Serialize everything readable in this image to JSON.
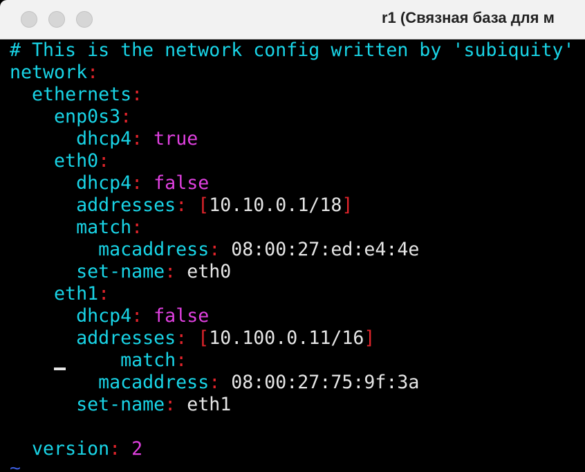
{
  "window": {
    "title": "r1 (Связная база для м"
  },
  "colors": {
    "key": "#19d4e6",
    "punct": "#e0242b",
    "literal": "#e040e0",
    "value": "#e6e6e6",
    "tilde": "#3a5bdc"
  },
  "lines": [
    {
      "comment": "# This is the network config written by 'subiquity'"
    },
    {
      "key": "network",
      "colon": ":"
    },
    {
      "indent": "  ",
      "key": "ethernets",
      "colon": ":"
    },
    {
      "indent": "    ",
      "key": "enp0s3",
      "colon": ":"
    },
    {
      "indent": "      ",
      "key": "dhcp4",
      "colon": ":",
      "sp": " ",
      "literal": "true"
    },
    {
      "indent": "    ",
      "key": "eth0",
      "colon": ":"
    },
    {
      "indent": "      ",
      "key": "dhcp4",
      "colon": ":",
      "sp": " ",
      "literal": "false"
    },
    {
      "indent": "      ",
      "key": "addresses",
      "colon": ":",
      "sp": " ",
      "lb": "[",
      "value": "10.10.0.1/18",
      "rb": "]"
    },
    {
      "indent": "      ",
      "key": "match",
      "colon": ":"
    },
    {
      "indent": "        ",
      "key": "macaddress",
      "colon": ":",
      "sp": " ",
      "value": "08:00:27:ed:e4:4e"
    },
    {
      "indent": "      ",
      "key": "set-name",
      "colon": ":",
      "sp": " ",
      "value": "eth0"
    },
    {
      "indent": "    ",
      "key": "eth1",
      "colon": ":"
    },
    {
      "indent": "      ",
      "key": "dhcp4",
      "colon": ":",
      "sp": " ",
      "literal": "false"
    },
    {
      "indent": "      ",
      "key": "addresses",
      "colon": ":",
      "sp": " ",
      "lb": "[",
      "value": "10.100.0.11/16",
      "rb": "]"
    },
    {
      "indent": "          ",
      "key": "match",
      "colon": ":"
    },
    {
      "indent": "        ",
      "key": "macaddress",
      "colon": ":",
      "sp": " ",
      "value": "08:00:27:75:9f:3a"
    },
    {
      "indent": "      ",
      "key": "set-name",
      "colon": ":",
      "sp": " ",
      "value": "eth1"
    },
    {},
    {
      "indent": "  ",
      "key": "version",
      "colon": ":",
      "sp": " ",
      "literal": "2"
    },
    {
      "tilde": "~"
    }
  ]
}
